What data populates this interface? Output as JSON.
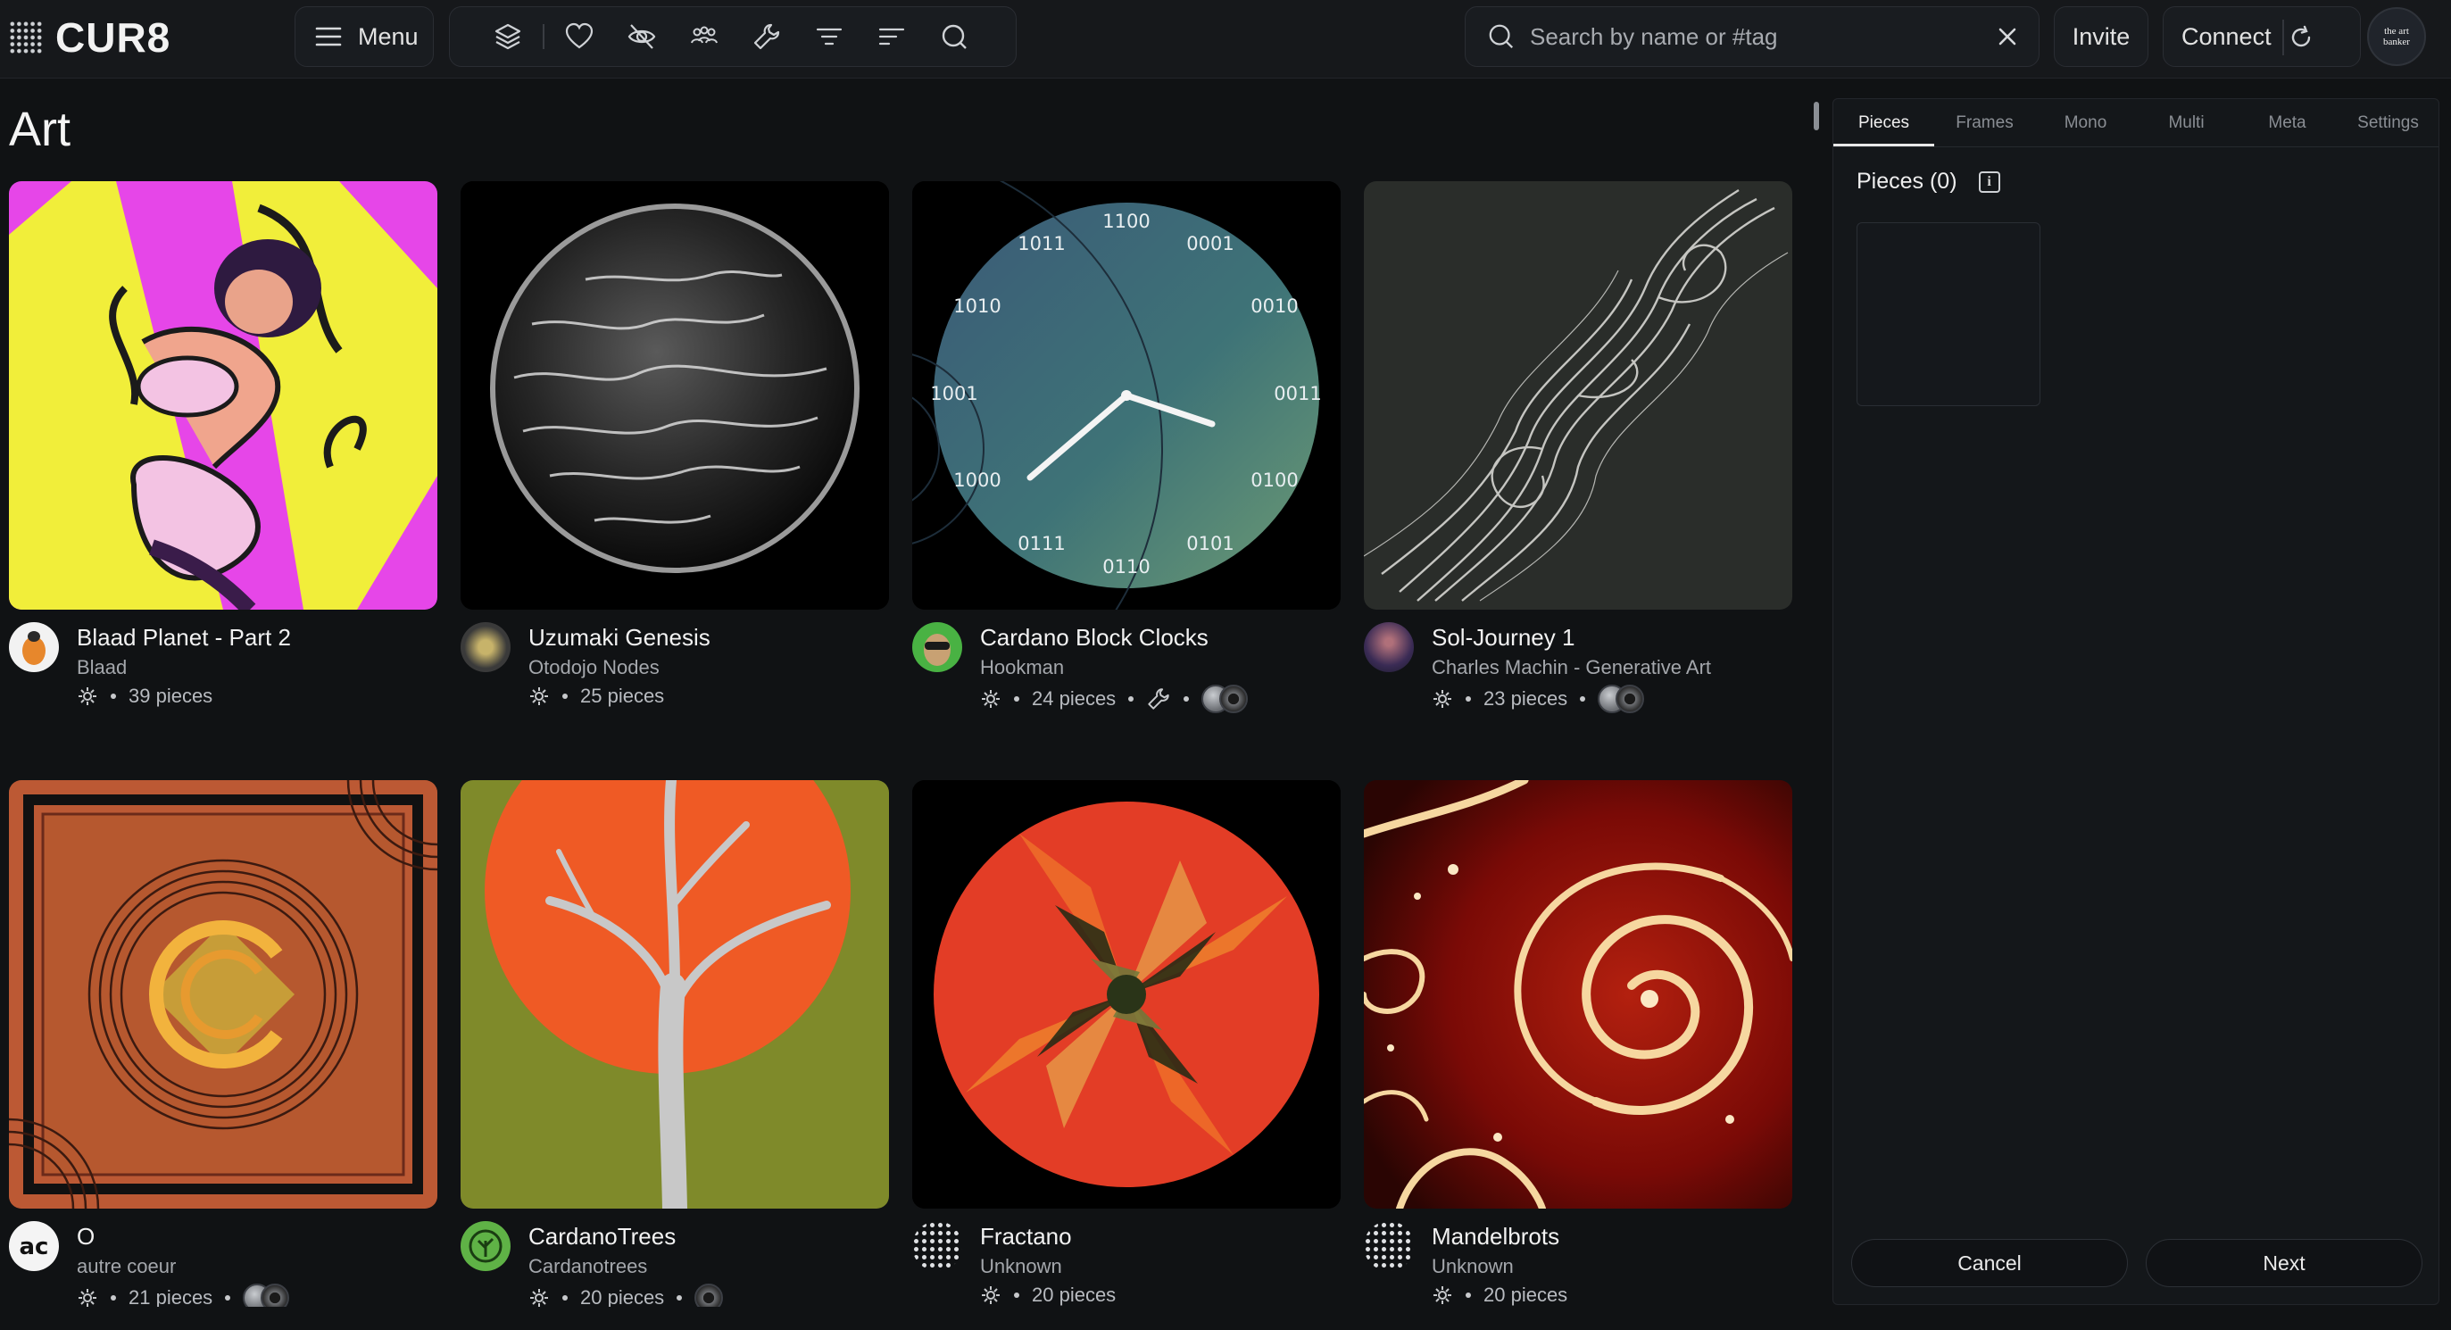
{
  "app": {
    "logo_text": "CUR8",
    "menu_label": "Menu",
    "search_placeholder": "Search by name or #tag",
    "invite_label": "Invite",
    "connect_label": "Connect",
    "avatar_text": "the art banker"
  },
  "toolbar": {
    "icons": [
      "layers-icon",
      "heart-icon",
      "eye-off-icon",
      "group-icon",
      "wrench-icon",
      "filter-icon",
      "sort-icon",
      "search-icon"
    ]
  },
  "page": {
    "title": "Art"
  },
  "cards": [
    {
      "title": "Blaad Planet - Part 2",
      "author": "Blaad",
      "pieces": "39 pieces",
      "tools": false,
      "chips": 0
    },
    {
      "title": "Uzumaki Genesis",
      "author": "Otodojo Nodes",
      "pieces": "25 pieces",
      "tools": false,
      "chips": 0
    },
    {
      "title": "Cardano Block Clocks",
      "author": "Hookman",
      "pieces": "24 pieces",
      "tools": true,
      "chips": 2
    },
    {
      "title": "Sol-Journey 1",
      "author": "Charles Machin - Generative Art",
      "pieces": "23 pieces",
      "tools": false,
      "chips": 2
    },
    {
      "title": "O",
      "author": "autre coeur",
      "pieces": "21 pieces",
      "tools": false,
      "chips": 2
    },
    {
      "title": "CardanoTrees",
      "author": "Cardanotrees",
      "pieces": "20 pieces",
      "tools": false,
      "chips": 1
    },
    {
      "title": "Fractano",
      "author": "Unknown",
      "pieces": "20 pieces",
      "tools": false,
      "chips": 0
    },
    {
      "title": "Mandelbrots",
      "author": "Unknown",
      "pieces": "20 pieces",
      "tools": false,
      "chips": 0
    }
  ],
  "clock": {
    "numerals": [
      "1100",
      "0001",
      "0010",
      "0011",
      "0100",
      "0101",
      "0110",
      "0111",
      "1000",
      "1001",
      "1010",
      "1011"
    ]
  },
  "panel": {
    "tabs": [
      "Pieces",
      "Frames",
      "Mono",
      "Multi",
      "Meta",
      "Settings"
    ],
    "active_tab": "Pieces",
    "pieces_heading": "Pieces (0)",
    "info_glyph": "i",
    "cancel_label": "Cancel",
    "next_label": "Next"
  }
}
